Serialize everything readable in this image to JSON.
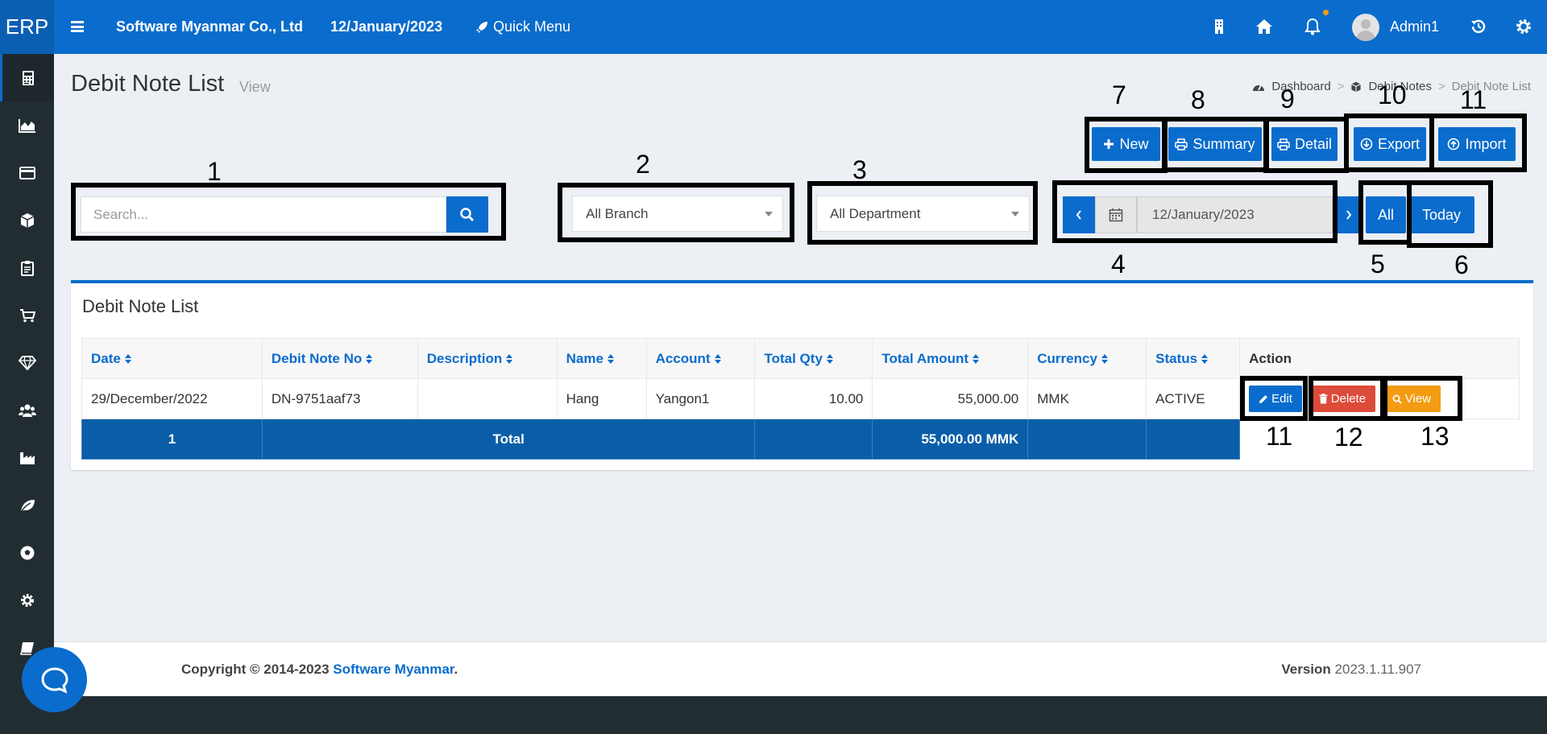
{
  "topbar": {
    "logo": "ERP",
    "company": "Software Myanmar Co., Ltd",
    "date": "12/January/2023",
    "quick_menu": "Quick Menu",
    "user": "Admin1",
    "icons": [
      "building-icon",
      "home-icon",
      "bell-icon",
      "history-icon",
      "gear-icon"
    ]
  },
  "sidebar": {
    "items": [
      "calculator-icon",
      "area-chart-icon",
      "credit-card-icon",
      "cube-icon",
      "clipboard-icon",
      "cart-icon",
      "diamond-icon",
      "users-icon",
      "industry-chart-icon",
      "leaf-icon",
      "soccer-icon",
      "cog-icon",
      "book-icon"
    ]
  },
  "header": {
    "title": "Debit Note List",
    "subtitle": "View",
    "breadcrumb": [
      "Dashboard",
      "Debit Notes",
      "Debit Note List"
    ]
  },
  "toolbar": {
    "new": "New",
    "summary": "Summary",
    "detail": "Detail",
    "export": "Export",
    "import": "Import"
  },
  "filters": {
    "search_placeholder": "Search...",
    "branch": "All Branch",
    "department": "All Department",
    "date": "12/January/2023",
    "all": "All",
    "today": "Today"
  },
  "annotations": [
    "1",
    "2",
    "3",
    "4",
    "5",
    "6",
    "7",
    "8",
    "9",
    "10",
    "11",
    "11",
    "12",
    "13"
  ],
  "table": {
    "title": "Debit Note List",
    "columns": [
      "Date",
      "Debit Note No",
      "Description",
      "Name",
      "Account",
      "Total Qty",
      "Total Amount",
      "Currency",
      "Status",
      "Action"
    ],
    "rows": [
      {
        "date": "29/December/2022",
        "no": "DN-9751aaf73",
        "description": "",
        "name": "Hang",
        "account": "Yangon1",
        "qty": "10.00",
        "amount": "55,000.00",
        "currency": "MMK",
        "status": "ACTIVE"
      }
    ],
    "actions": {
      "edit": "Edit",
      "delete": "Delete",
      "view": "View"
    },
    "total": {
      "count": "1",
      "label": "Total",
      "amount": "55,000.00 MMK"
    }
  },
  "footer": {
    "copyright": "Copyright © 2014-2023",
    "company_link": "Software Myanmar",
    "period": ".",
    "version_label": "Version",
    "version": "2023.1.11.907"
  },
  "colors": {
    "primary": "#0a6ccc",
    "sidebar": "#222d32",
    "delete": "#dd4b39",
    "view": "#f39c12"
  }
}
